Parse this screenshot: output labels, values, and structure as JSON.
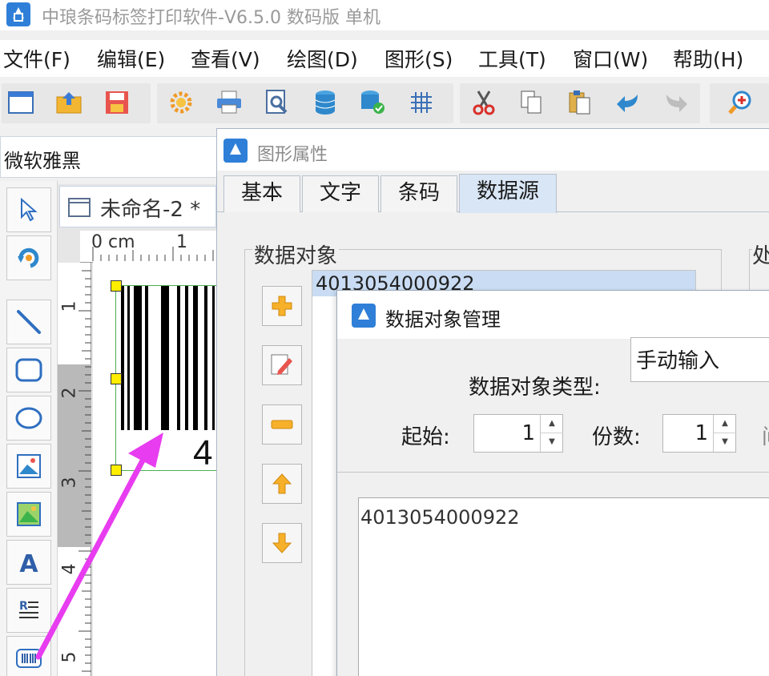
{
  "window": {
    "title": "中琅条码标签打印软件-V6.5.0 数码版 单机"
  },
  "menu": {
    "items": [
      "文件(F)",
      "编辑(E)",
      "查看(V)",
      "绘图(D)",
      "图形(S)",
      "工具(T)",
      "窗口(W)",
      "帮助(H)"
    ]
  },
  "toolbar": {
    "buttons": [
      "new-document",
      "open-file",
      "save",
      "settings",
      "print",
      "print-preview",
      "database",
      "database-connect",
      "grid",
      "cut",
      "copy",
      "paste",
      "undo",
      "redo",
      "zoom-in"
    ]
  },
  "font_selector": {
    "value": "微软雅黑"
  },
  "document": {
    "tab_title": "未命名-2 *",
    "ruler_top": [
      "0 cm",
      "1"
    ],
    "ruler_left": [
      "1",
      "2",
      "3",
      "4",
      "5"
    ],
    "barcode_digit": "4"
  },
  "properties_dialog": {
    "title": "图形属性",
    "tabs": [
      "基本",
      "文字",
      "条码",
      "数据源"
    ],
    "active_tab": "数据源",
    "data_objects_label": "数据对象",
    "processing_label": "处",
    "data_objects": [
      "4013054000922"
    ]
  },
  "data_object_dialog": {
    "title": "数据对象管理",
    "type_label": "数据对象类型:",
    "type_value": "手动输入",
    "start_label": "起始:",
    "start_value": "1",
    "copies_label": "份数:",
    "copies_value": "1",
    "trailing_label": "间",
    "content": "4013054000922"
  },
  "colors": {
    "accent": "#3a7bd5",
    "highlight": "#c9dcf3",
    "annotation_arrow": "#e83cf0"
  }
}
